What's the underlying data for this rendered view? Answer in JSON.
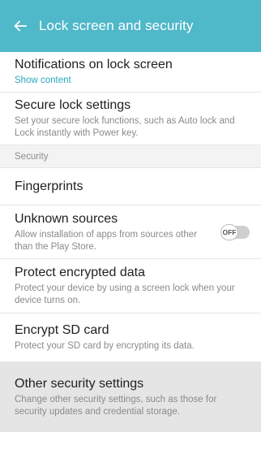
{
  "appbar": {
    "title": "Lock screen and security",
    "back_icon": "arrow-left-icon",
    "color": "#4fb8c9"
  },
  "items": {
    "notifications": {
      "title": "Notifications on lock screen",
      "subtitle": "Show content"
    },
    "secure_lock": {
      "title": "Secure lock settings",
      "subtitle": "Set your secure lock functions, such as Auto lock and Lock instantly with Power key."
    },
    "section_security": "Security",
    "fingerprints": {
      "title": "Fingerprints"
    },
    "unknown_sources": {
      "title": "Unknown sources",
      "subtitle": "Allow installation of apps from sources other than the Play Store.",
      "toggle_label": "OFF",
      "toggle_on": false
    },
    "protect_encrypted": {
      "title": "Protect encrypted data",
      "subtitle": "Protect your device by using a screen lock when your device turns on."
    },
    "encrypt_sd": {
      "title": "Encrypt SD card",
      "subtitle": "Protect your SD card by encrypting its data."
    },
    "other_security": {
      "title": "Other security settings",
      "subtitle": "Change other security settings, such as those for security updates and credential storage."
    }
  }
}
